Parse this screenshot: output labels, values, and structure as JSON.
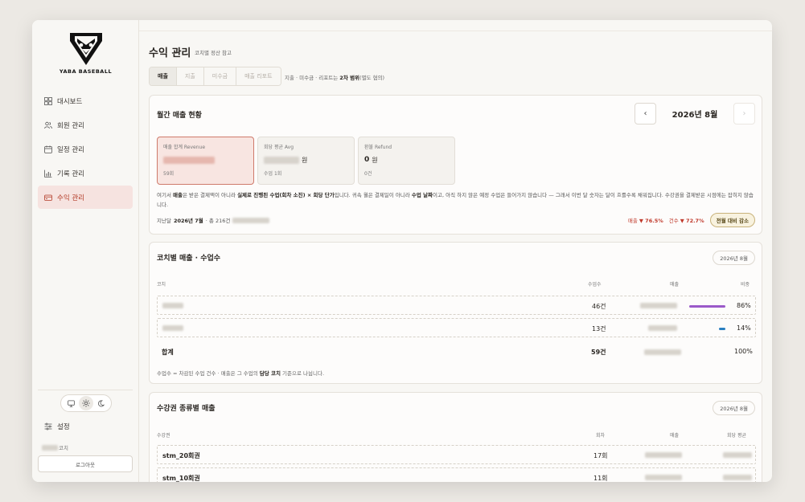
{
  "brand": {
    "name": "YABA BASEBALL"
  },
  "sidebar": {
    "items": [
      {
        "label": "대시보드",
        "icon": "grid-icon"
      },
      {
        "label": "회원 관리",
        "icon": "users-icon"
      },
      {
        "label": "일정 관리",
        "icon": "calendar-icon"
      },
      {
        "label": "기록 관리",
        "icon": "bar-chart-icon"
      },
      {
        "label": "수익 관리",
        "icon": "wallet-icon",
        "active": true
      }
    ],
    "settings_label": "설정",
    "user_suffix": "코치",
    "logout_label": "로그아웃",
    "theme": {
      "options": [
        "monitor-icon",
        "sun-icon",
        "moon-icon"
      ],
      "selected": "sun-icon"
    }
  },
  "page": {
    "title": "수익 관리",
    "subtitle": "코치별 정산 참고"
  },
  "tabs": [
    {
      "label": "매출",
      "active": true
    },
    {
      "label": "지출"
    },
    {
      "label": "미수금"
    },
    {
      "label": "매출 리포트"
    }
  ],
  "tabs_note": {
    "prefix": "지출 · 미수금 · 리포트는 ",
    "bold": "2차 범위",
    "suffix": "(별도 협의)"
  },
  "monthly": {
    "title": "월간 매출 현황",
    "month": "2026년 8월",
    "prev": "‹",
    "next": "›",
    "kpis": [
      {
        "label": "매출 합계 Revenue",
        "value": "",
        "unit": "",
        "sub": "59회",
        "highlight": true
      },
      {
        "label": "회당 평균 Avg",
        "value": "",
        "unit": "원",
        "sub": "수업 1회"
      },
      {
        "label": "환불 Refund",
        "value": "0",
        "unit": "원",
        "sub": "0건"
      }
    ],
    "note": {
      "p1": "여기서 ",
      "b1": "매출",
      "p2": "은 받은 결제액이 아니라 ",
      "b2": "실제로 진행된 수업(회차 소진) × 회당 단가",
      "p3": "입니다. 귀속 월은 결제일이 아니라 ",
      "b3": "수업 날짜",
      "p4": "이고, 아직 하지 않은 예정 수업은 들어가지 않습니다 — 그래서 이번 달 숫자는 달이 흐를수록 채워집니다. 수강권을 결제받은 시점에는 잡히지 않습니다."
    },
    "compare": {
      "prefix": "지난달 ",
      "month": "2026년 7월",
      "mid": " · 총 216건",
      "revenue_label": "매출",
      "revenue_change": "▼ 76.5%",
      "count_label": "건수",
      "count_change": "▼ 72.7%",
      "pill": "전월 대비 감소"
    }
  },
  "coach_table": {
    "title": "코치별 매출 · 수업수",
    "badge": "2026년 8월",
    "headers": {
      "coach": "코치",
      "count": "수업수",
      "revenue": "매출",
      "share": "비중"
    },
    "rows": [
      {
        "count": "46건",
        "share": "86%",
        "share_value": 0.86,
        "color": "#9b59c9"
      },
      {
        "count": "13건",
        "share": "14%",
        "share_value": 0.14,
        "color": "#2a7fc0"
      }
    ],
    "total": {
      "label": "합계",
      "count": "59건",
      "share": "100%"
    },
    "footnote": {
      "p1": "수업수 = 차감된 수업 건수 · 매출은 그 수업의 ",
      "b1": "담당 코치",
      "p2": " 기준으로 나뉩니다."
    }
  },
  "ticket_table": {
    "title": "수강권 종류별 매출",
    "badge": "2026년 8월",
    "headers": {
      "ticket": "수강권",
      "sessions": "회차",
      "revenue": "매출",
      "per": "회당 평균"
    },
    "rows": [
      {
        "name": "stm_20회권",
        "sessions": "17회"
      },
      {
        "name": "stm_10회권",
        "sessions": "11회"
      }
    ]
  }
}
